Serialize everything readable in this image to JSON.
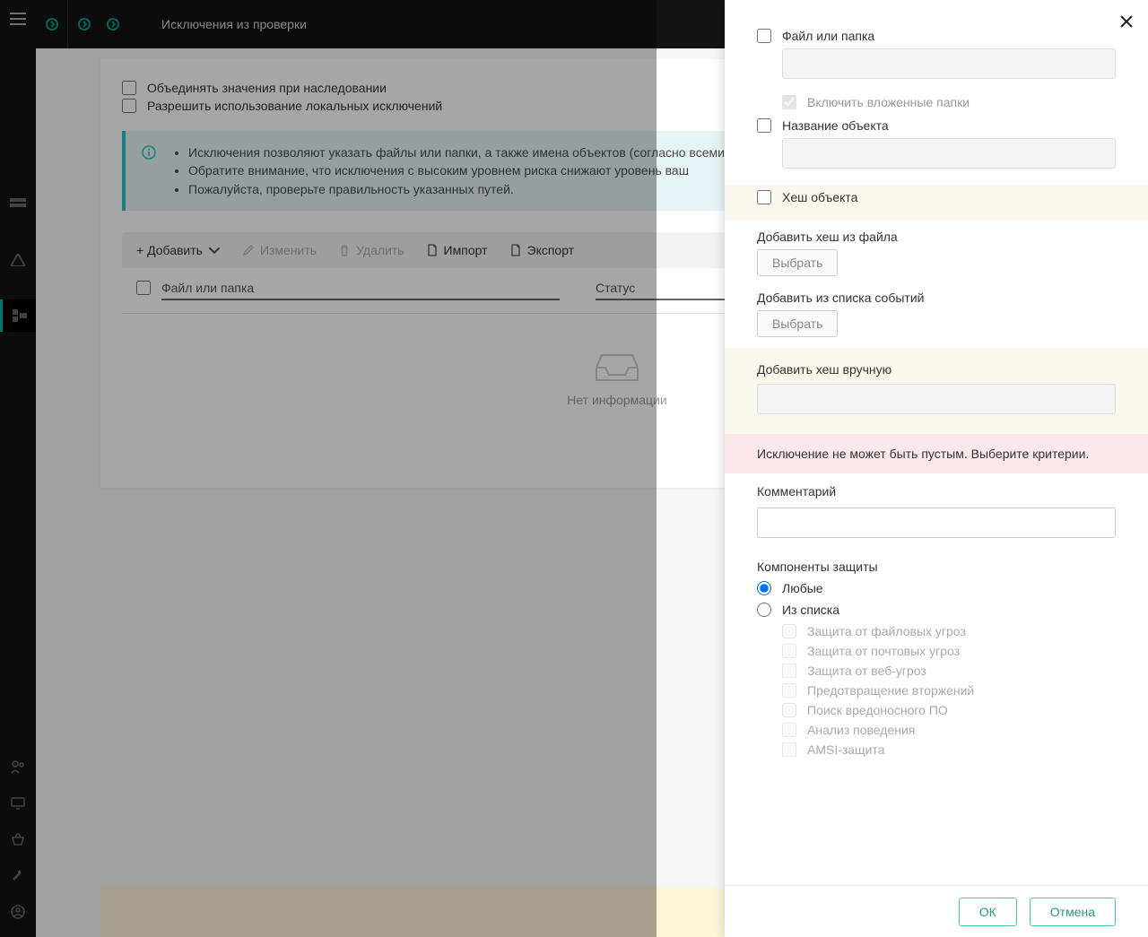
{
  "header": {
    "title": "Исключения из проверки"
  },
  "content": {
    "merge_on_inherit": "Объединять значения при наследовании",
    "allow_local": "Разрешить использование локальных исключений",
    "info": [
      "Исключения позволяют указать файлы или папки, а также имена объектов (согласно всеми или некоторыми компонентами приложения.",
      "Обратите внимание, что исключения с высоким уровнем риска снижают уровень ваш",
      "Пожалуйста, проверьте правильность указанных путей."
    ],
    "toolbar": {
      "add": "+ Добавить",
      "edit": "Изменить",
      "delete": "Удалить",
      "import": "Импорт",
      "export": "Экспорт"
    },
    "table": {
      "col_file": "Файл или папка",
      "col_status": "Статус"
    },
    "empty": "Нет информации"
  },
  "panel": {
    "file_or_folder": "Файл или папка",
    "include_subfolders": "Включить вложенные папки",
    "object_name": "Название объекта",
    "object_hash": "Хеш объекта",
    "add_hash_from_file": "Добавить хеш из файла",
    "add_from_events": "Добавить из списка событий",
    "add_hash_manual": "Добавить хеш вручную",
    "choose": "Выбрать",
    "error": "Исключение не может быть пустым. Выберите критерии.",
    "comment_label": "Комментарий",
    "components_label": "Компоненты защиты",
    "radio_any": "Любые",
    "radio_from_list": "Из списка",
    "components": [
      "Защита от файловых угроз",
      "Защита от почтовых угроз",
      "Защита от веб-угроз",
      "Предотвращение вторжений",
      "Поиск вредоносного ПО",
      "Анализ поведения",
      "AMSI-защита"
    ],
    "ok": "ОК",
    "cancel": "Отмена"
  }
}
